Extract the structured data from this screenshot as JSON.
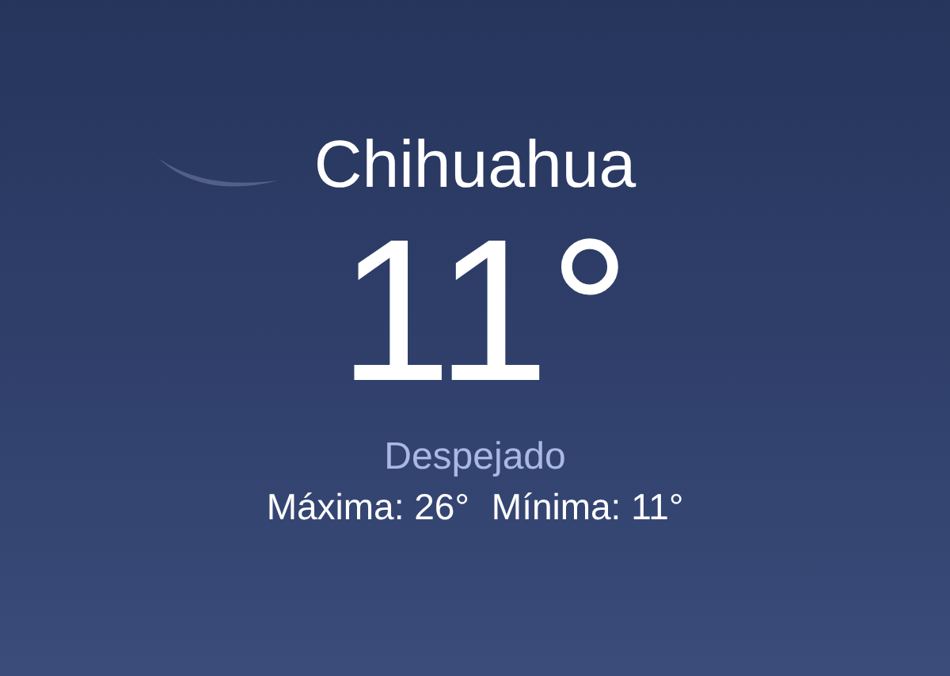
{
  "city": "Chihuahua",
  "temperature": "11°",
  "condition": "Despejado",
  "high": "Máxima: 26°",
  "low": "Mínima: 11°"
}
